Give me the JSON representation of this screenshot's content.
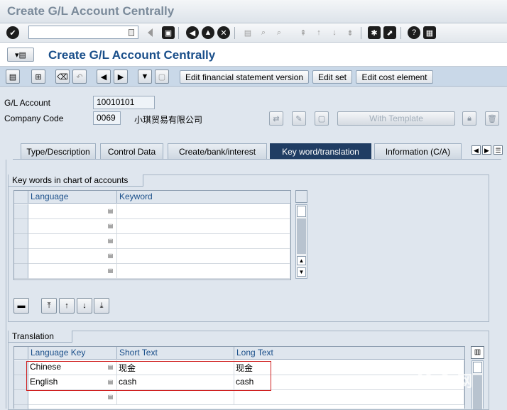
{
  "window": {
    "title": "Create G/L Account Centrally"
  },
  "command_field": {
    "value": ""
  },
  "screen": {
    "title": "Create G/L Account Centrally"
  },
  "app_toolbar": {
    "edit_fs_version": "Edit financial statement version",
    "edit_set": "Edit set",
    "edit_cost_element": "Edit cost element"
  },
  "header": {
    "gl_account_label": "G/L Account",
    "gl_account_value": "10010101",
    "company_code_label": "Company Code",
    "company_code_value": "0069",
    "company_name": "小琪贸易有限公司",
    "with_template": "With Template"
  },
  "tabs": [
    {
      "label": "Type/Description"
    },
    {
      "label": "Control Data"
    },
    {
      "label": "Create/bank/interest"
    },
    {
      "label": "Key word/translation"
    },
    {
      "label": "Information (C/A)"
    }
  ],
  "keywords": {
    "title": "Key words in chart of accounts",
    "col_language": "Language",
    "col_keyword": "Keyword"
  },
  "translation": {
    "title": "Translation",
    "col_language_key": "Language Key",
    "col_short_text": "Short Text",
    "col_long_text": "Long Text",
    "rows": [
      {
        "language": "Chinese",
        "short": "现金",
        "long": "现金"
      },
      {
        "language": "English",
        "short": "cash",
        "long": "cash"
      },
      {
        "language": "",
        "short": "",
        "long": ""
      }
    ]
  },
  "colors": {
    "accent": "#1a4f8a",
    "active_tab": "#203d63",
    "highlight": "#d02020"
  }
}
